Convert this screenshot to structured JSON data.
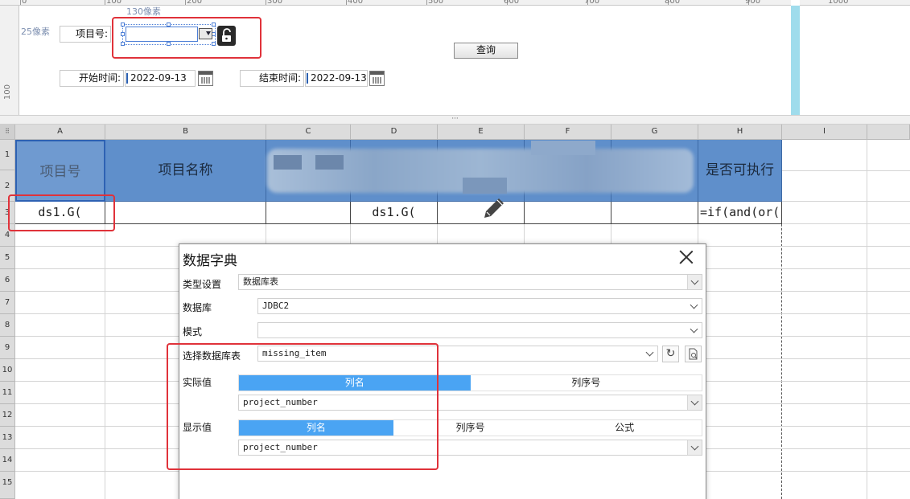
{
  "ruler": {
    "h_labels": [
      "0",
      "100",
      "200",
      "300",
      "400",
      "500",
      "600",
      "700",
      "800",
      "900",
      "1000"
    ],
    "v_label": "100"
  },
  "design": {
    "hint_width": "130像素",
    "hint_height": "25像素",
    "project_label": "项目号:",
    "query_button": "查询",
    "start_label": "开始时间:",
    "start_value": "2022-09-13",
    "end_label": "结束时间:",
    "end_value": "2022-09-13",
    "lock_icon": "unlock-icon",
    "calendar_icon": "calendar-icon"
  },
  "sheet": {
    "columns": [
      "A",
      "B",
      "C",
      "D",
      "E",
      "F",
      "G",
      "H",
      "I"
    ],
    "rows": [
      "1",
      "2",
      "3",
      "4",
      "5",
      "6",
      "7",
      "8",
      "9",
      "10",
      "11",
      "12",
      "13",
      "14",
      "15"
    ],
    "header_cells": {
      "a": "项目号",
      "b": "项目名称",
      "h": "是否可执行"
    },
    "data_cells": {
      "a": "ds1.G(",
      "d": "ds1.G(",
      "h": "=if(and(or("
    },
    "header_color": "#5f8fcb",
    "edit_icon": "pencil-icon"
  },
  "dialog": {
    "title": "数据字典",
    "type_label": "类型设置",
    "type_value": "数据库表",
    "db_label": "数据库",
    "db_value": "JDBC2",
    "schema_label": "模式",
    "schema_value": "",
    "table_label": "选择数据库表",
    "table_value": "missing_item",
    "actual_label": "实际值",
    "actual_tabs": [
      "列名",
      "列序号"
    ],
    "actual_value": "project_number",
    "display_label": "显示值",
    "display_tabs": [
      "列名",
      "列序号",
      "公式"
    ],
    "display_value": "project_number",
    "refresh_icon": "refresh-icon",
    "preview_icon": "preview-icon",
    "accent": "#4aa4f3"
  },
  "annotation_color": "#e0323a"
}
